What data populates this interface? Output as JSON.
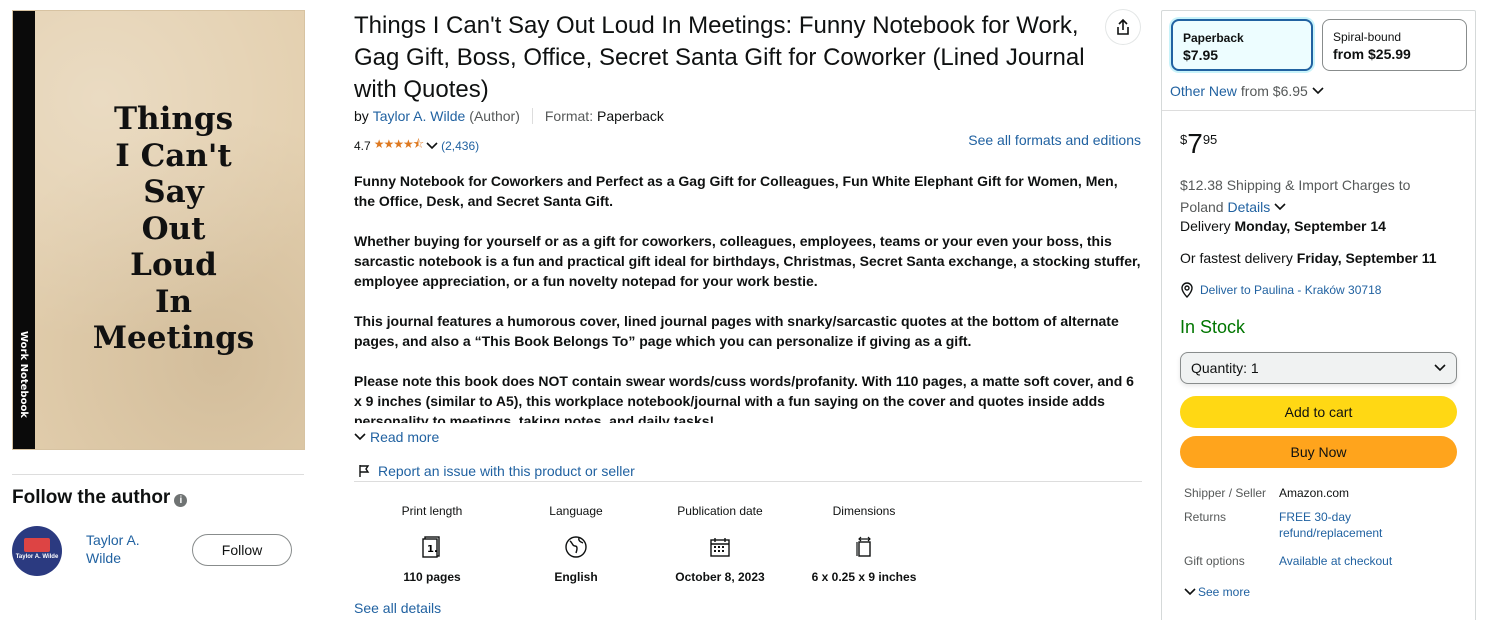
{
  "cover": {
    "title": "Things\nI Can't\nSay\nOut\nLoud\nIn\nMeetings",
    "spine_text": "Work Notebook"
  },
  "author_section": {
    "heading": "Follow the author",
    "info_icon": "i",
    "name": "Taylor A. Wilde",
    "avatar_text": "Taylor A. Wilde",
    "follow_label": "Follow"
  },
  "product": {
    "title": "Things I Can't Say Out Loud In Meetings: Funny Notebook for Work, Gag Gift, Boss, Office, Secret Santa Gift for Coworker (Lined Journal with Quotes)",
    "by_label": "by",
    "author": "Taylor A. Wilde",
    "author_role": "(Author)",
    "format_label": "Format:",
    "format_value": "Paperback",
    "rating": "4.7",
    "stars": "★★★★⯪",
    "rating_count": "(2,436)",
    "see_formats": "See all formats and editions",
    "description": [
      "Funny Notebook for Coworkers and Perfect as a Gag Gift for Colleagues, Fun White Elephant Gift for Women, Men, the Office, Desk, and Secret Santa Gift.",
      "Whether buying for yourself or as a gift for coworkers, colleagues, employees, teams or your even your boss, this sarcastic notebook is a fun and practical gift ideal for birthdays, Christmas, Secret Santa exchange, a stocking stuffer, employee appreciation, or a fun novelty notepad for your work bestie.",
      "This journal features a humorous cover, lined journal pages with snarky/sarcastic quotes at the bottom of alternate pages, and also a “This Book Belongs To” page which you can personalize if giving as a gift.",
      "Please note this book does NOT contain swear words/cuss words/profanity. With 110 pages, a matte soft cover, and 6 x 9 inches (similar to A5), this workplace notebook/journal with a fun saying on the cover and quotes inside adds personality to meetings, taking notes, and daily tasks!"
    ],
    "read_more": "Read more",
    "report": "Report an issue with this product or seller",
    "specs": [
      {
        "label": "Print length",
        "value": "110 pages",
        "icon": "pages-icon"
      },
      {
        "label": "Language",
        "value": "English",
        "icon": "globe-icon"
      },
      {
        "label": "Publication date",
        "value": "October 8, 2023",
        "icon": "calendar-icon"
      },
      {
        "label": "Dimensions",
        "value": "6 x 0.25 x 9 inches",
        "icon": "dimensions-icon"
      }
    ],
    "see_all_details": "See all details"
  },
  "buybox": {
    "formats": [
      {
        "name": "Paperback",
        "price": "$7.95",
        "selected": true
      },
      {
        "name": "Spiral-bound",
        "price": "from $25.99",
        "selected": false
      }
    ],
    "other_new_prefix": "Other New",
    "other_new_from": "from $6.95",
    "price_symbol": "$",
    "price_whole": "7",
    "price_fraction": "95",
    "shipping_text": "$12.38 Shipping & Import Charges to Poland",
    "shipping_details": "Details",
    "delivery_prefix": "Delivery",
    "delivery_date": "Monday, September 14",
    "fastest_prefix": "Or fastest delivery",
    "fastest_date": "Friday, September 11",
    "deliver_to": "Deliver to Paulina - Kraków 30718",
    "stock": "In Stock",
    "quantity_label": "Quantity:",
    "quantity_value": "1",
    "add_to_cart": "Add to cart",
    "buy_now": "Buy Now",
    "meta": [
      {
        "key": "Shipper / Seller",
        "value": "Amazon.com",
        "link": false
      },
      {
        "key": "Returns",
        "value": "FREE 30-day refund/replacement",
        "link": true
      },
      {
        "key": "Gift options",
        "value": "Available at checkout",
        "link": true
      }
    ],
    "see_more": "See more"
  },
  "colors": {
    "link": "#2162a1",
    "in_stock": "#007600",
    "add_to_cart": "#ffd814",
    "buy_now": "#ffa41c",
    "star": "#de7921"
  }
}
